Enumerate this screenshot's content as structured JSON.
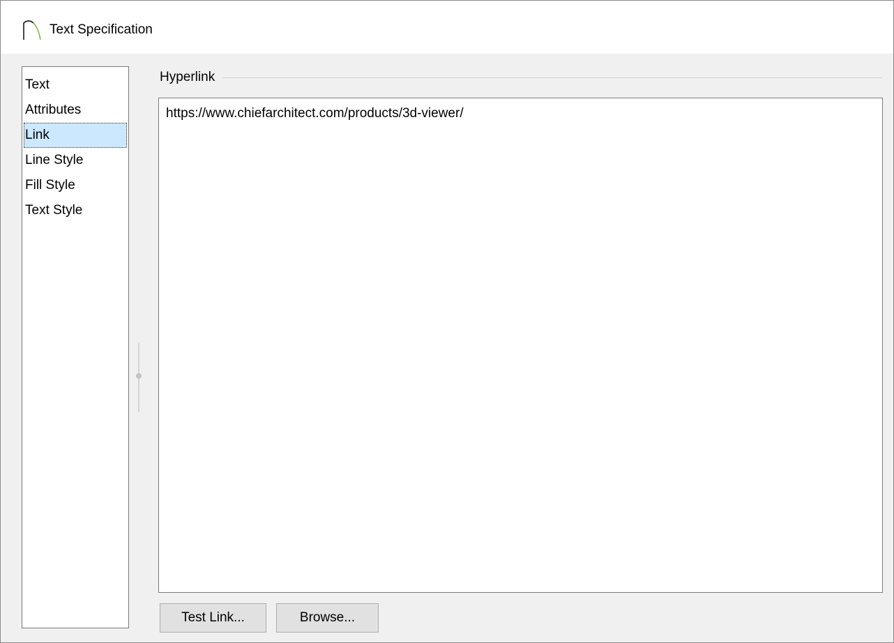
{
  "window": {
    "title": "Text Specification",
    "icon": "chief-architect-arch-icon"
  },
  "sidebar": {
    "items": [
      {
        "label": "Text",
        "selected": false
      },
      {
        "label": "Attributes",
        "selected": false
      },
      {
        "label": "Link",
        "selected": true
      },
      {
        "label": "Line Style",
        "selected": false
      },
      {
        "label": "Fill Style",
        "selected": false
      },
      {
        "label": "Text Style",
        "selected": false
      }
    ]
  },
  "hyperlink": {
    "group_label": "Hyperlink",
    "value": "https://www.chiefarchitect.com/products/3d-viewer/"
  },
  "buttons": {
    "test_link": "Test Link...",
    "browse": "Browse..."
  },
  "colors": {
    "selection": "#cce8ff",
    "client_background": "#f0f0f0",
    "button_face": "#e1e1e1",
    "icon_stroke_left": "#1a1a1a",
    "icon_stroke_right": "#7cc242"
  }
}
